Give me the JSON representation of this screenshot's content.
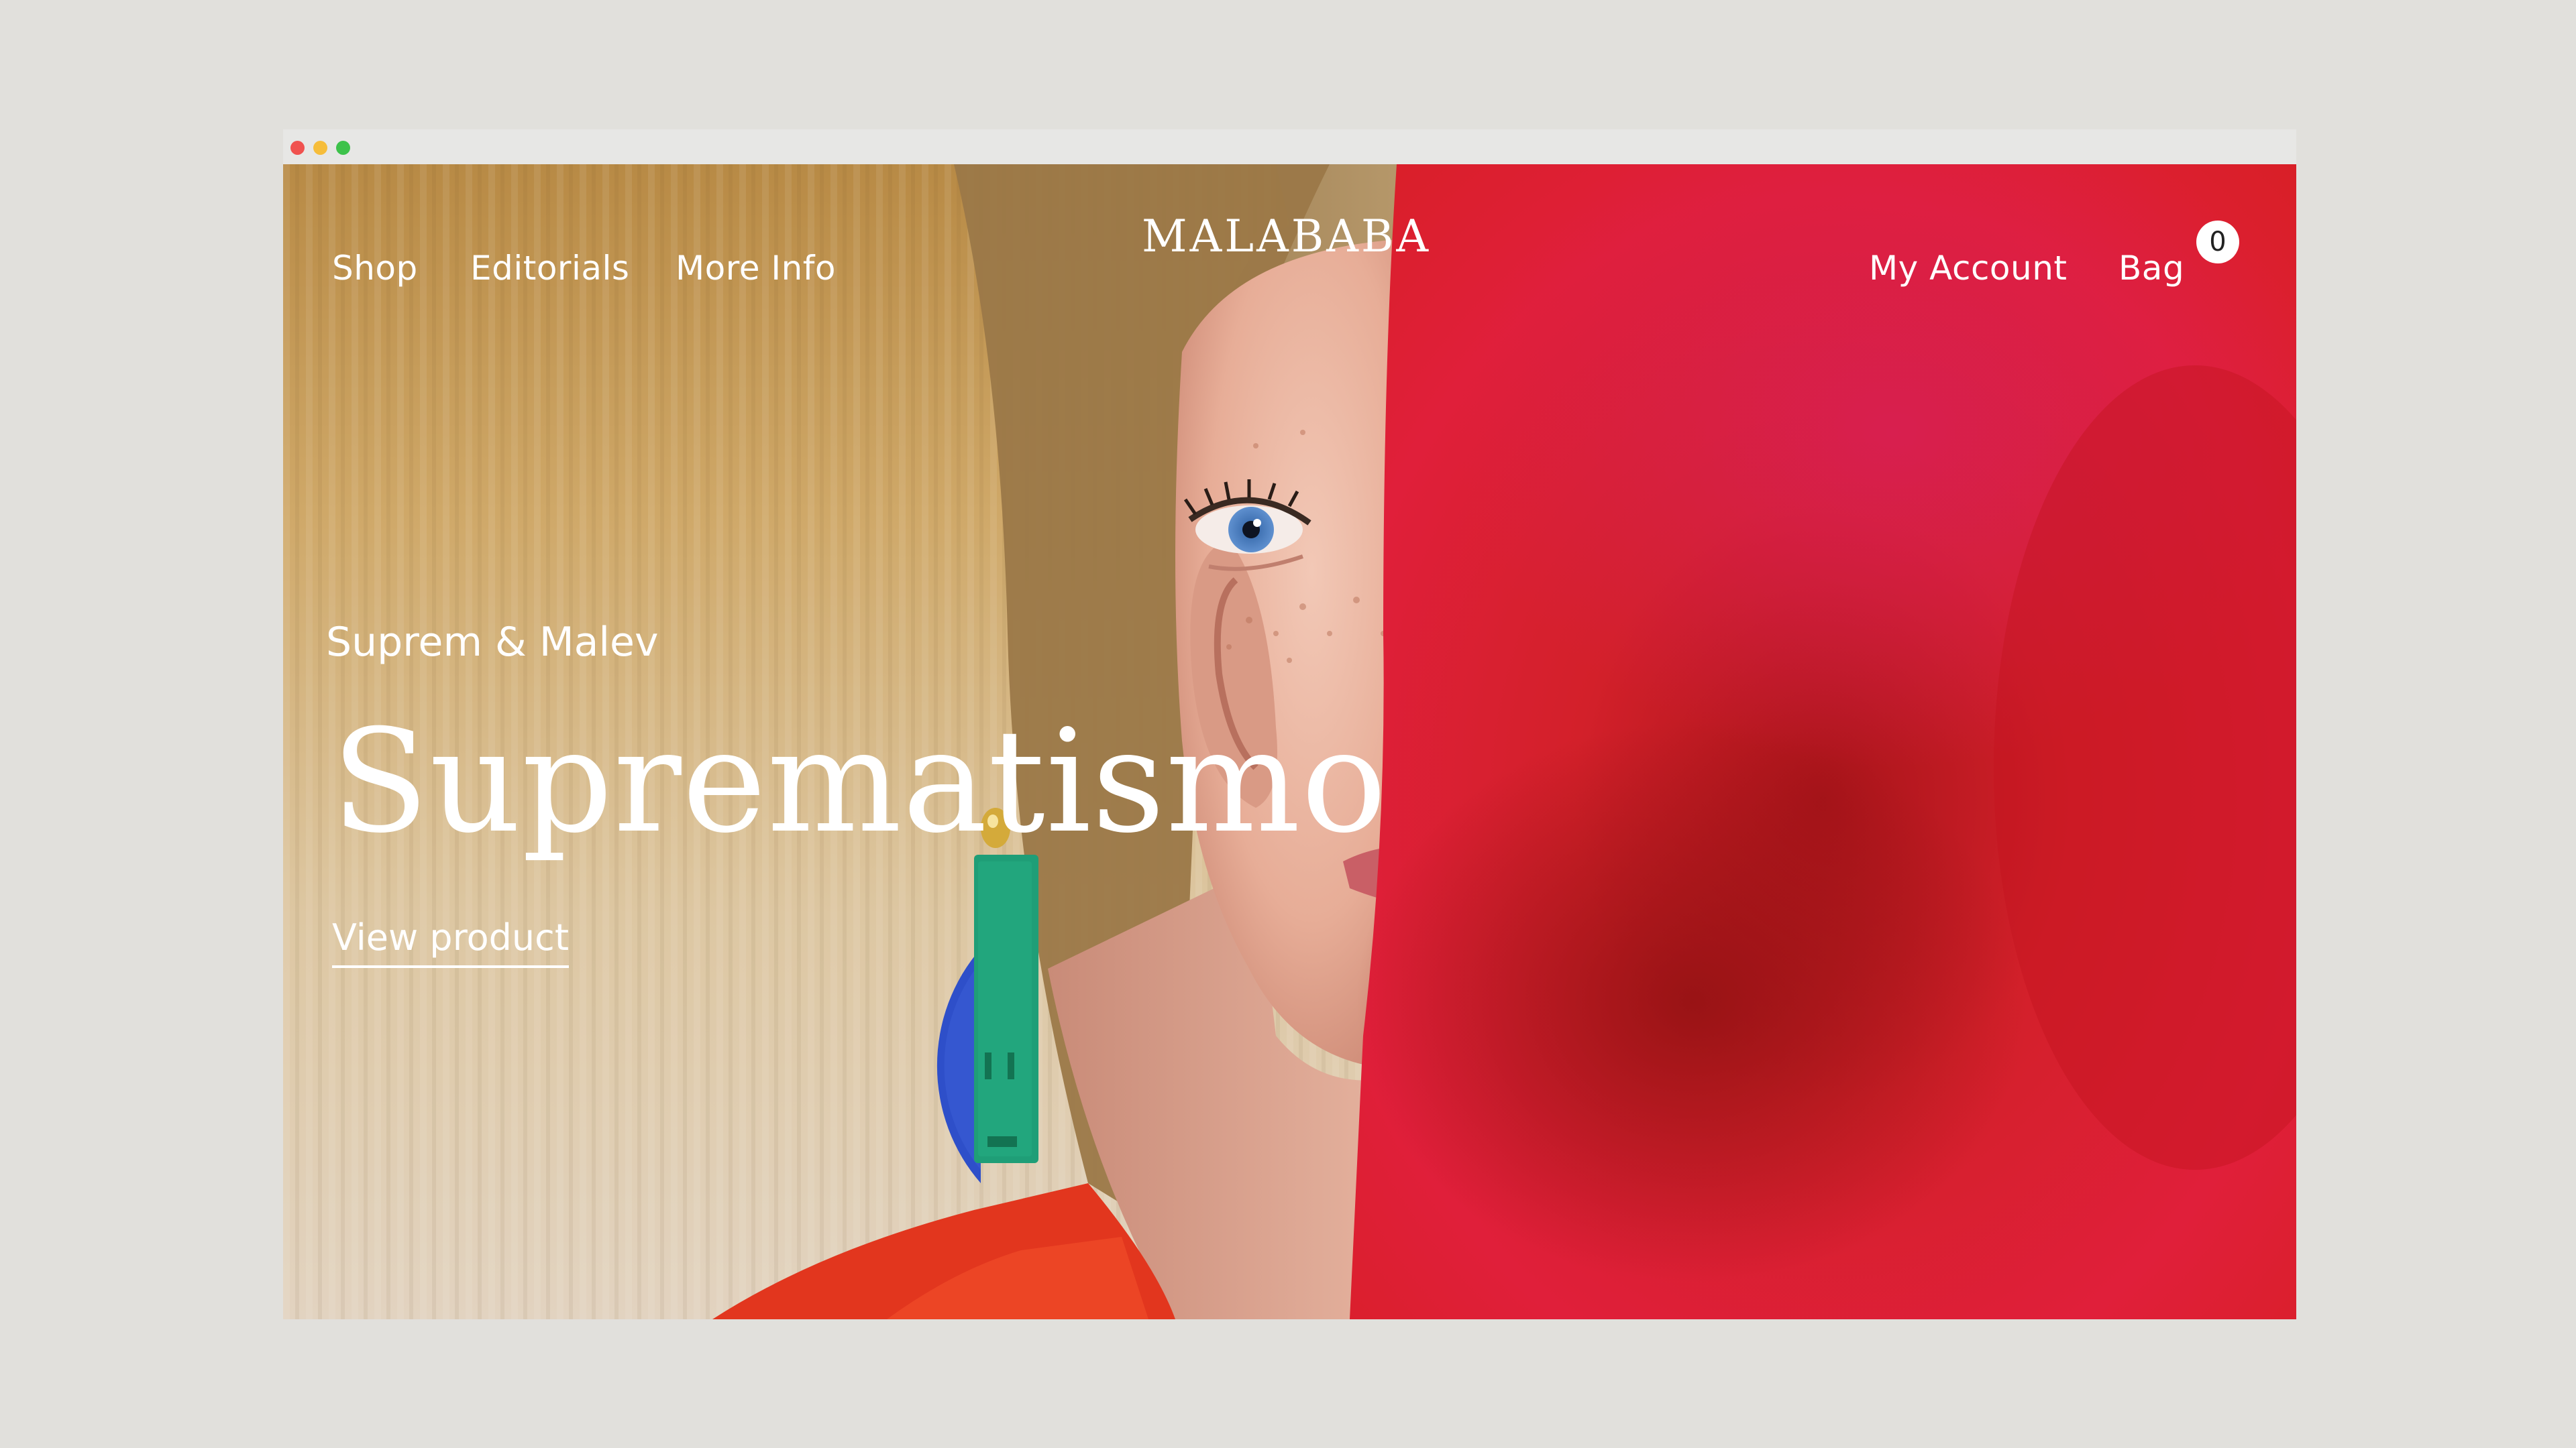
{
  "window": {
    "controls": [
      "close",
      "minimize",
      "maximize"
    ]
  },
  "nav": {
    "left": [
      {
        "label": "Shop"
      },
      {
        "label": "Editorials"
      },
      {
        "label": "More Info"
      }
    ],
    "logo": "MALABABA",
    "account_label": "My Account",
    "bag_label": "Bag",
    "bag_count": "0"
  },
  "hero": {
    "subtitle": "Suprem & Malev",
    "title": "Suprematismo",
    "cta": "View product"
  },
  "colors": {
    "page_background": "#e1e0dc",
    "hero_red": "#d91e24",
    "earring_blue": "#2e4fc9",
    "earring_green": "#1f9e77",
    "text": "#ffffff"
  }
}
